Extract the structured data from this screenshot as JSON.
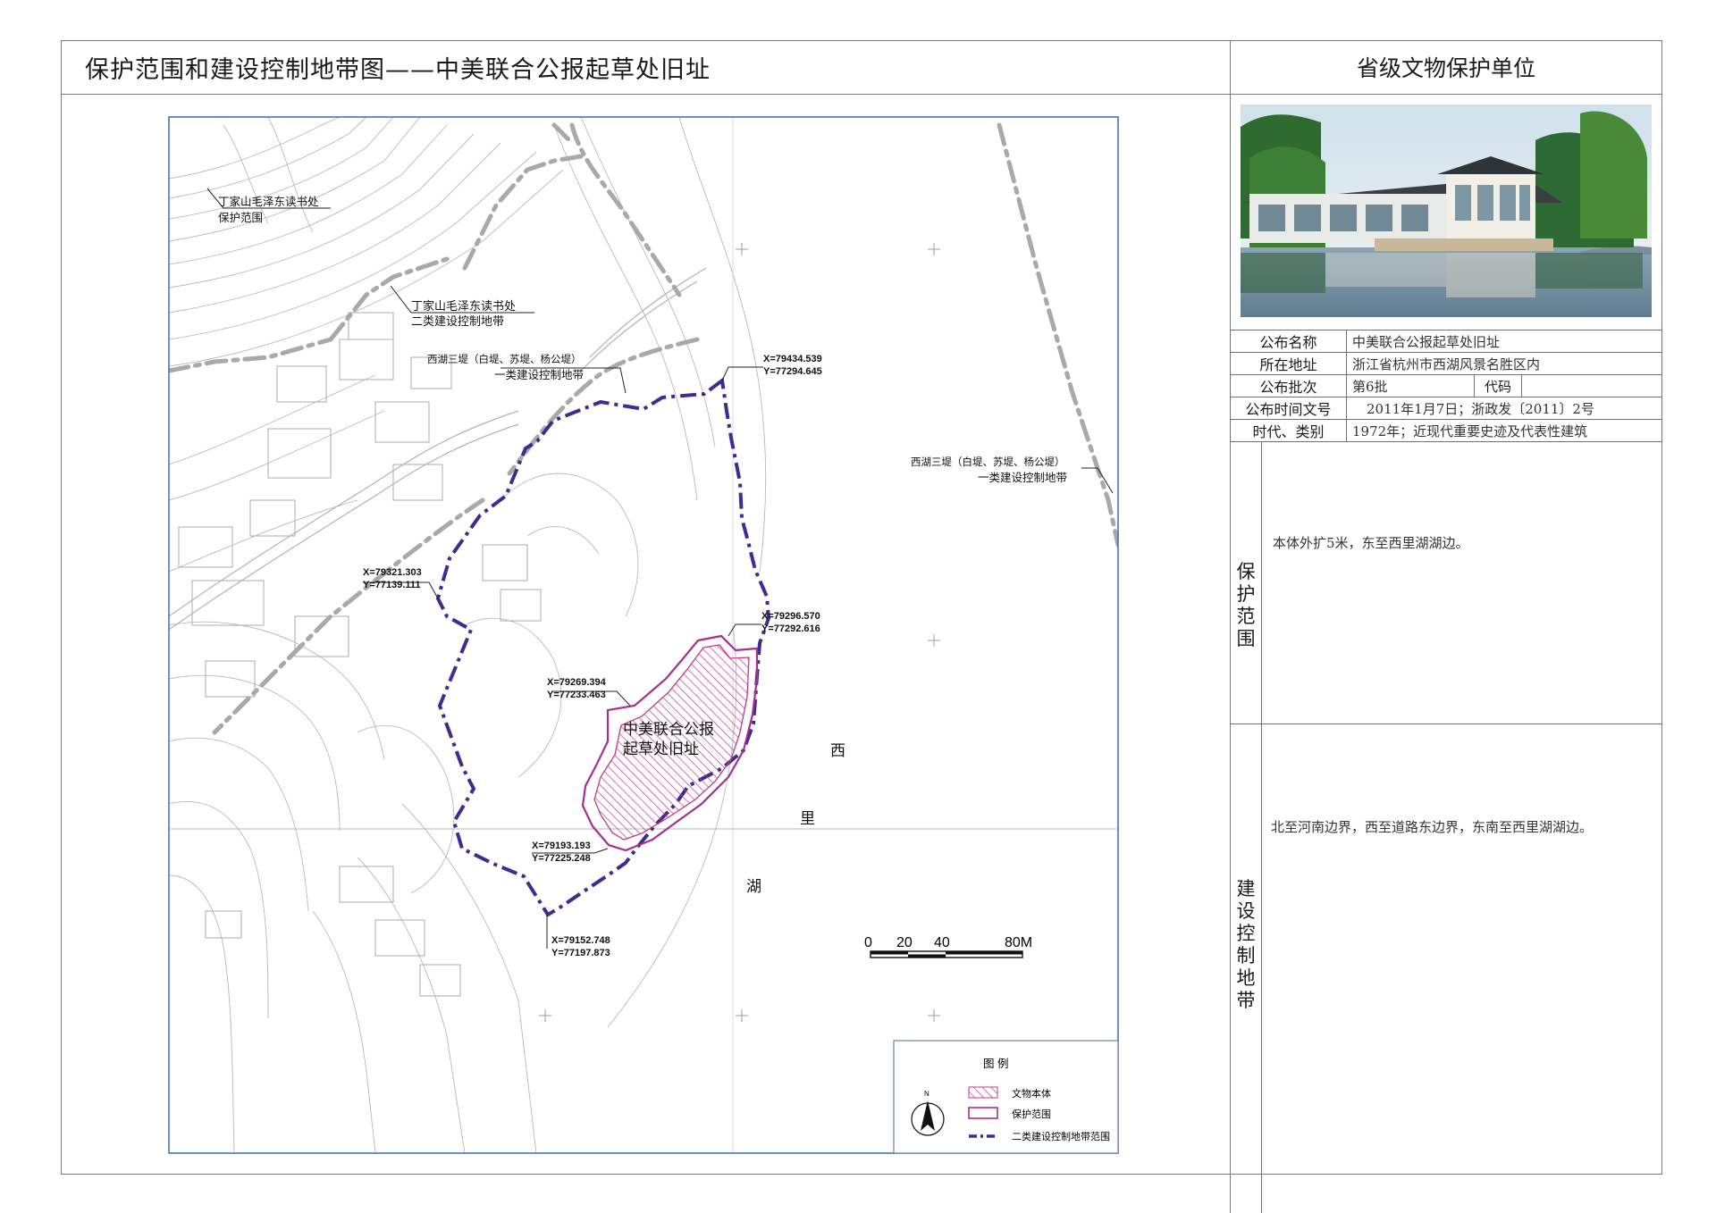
{
  "title": "保护范围和建设控制地带图——中美联合公报起草处旧址",
  "level": "省级文物保护单位",
  "map": {
    "labels": {
      "dingjia_protect_1": "丁家山毛泽东读书处",
      "dingjia_protect_2": "保护范围",
      "dingjia_control_1": "丁家山毛泽东读书处",
      "dingjia_control_2": "二类建设控制地带",
      "xihu_left_1": "西湖三堤（白堤、苏堤、杨公堤）",
      "xihu_left_2": "一类建设控制地带",
      "xihu_right_1": "西湖三堤（白堤、苏堤、杨公堤）",
      "xihu_right_2": "一类建设控制地带",
      "site_1": "中美联合公报",
      "site_2": "起草处旧址",
      "lake_1": "西",
      "lake_2": "里",
      "lake_3": "湖"
    },
    "coords": [
      {
        "x": "X=79434.539",
        "y": "Y=77294.645"
      },
      {
        "x": "X=79321.303",
        "y": "Y=77139.111"
      },
      {
        "x": "X=79296.570",
        "y": "Y=77292.616"
      },
      {
        "x": "X=79269.394",
        "y": "Y=77233.463"
      },
      {
        "x": "X=79193.193",
        "y": "Y=77225.248"
      },
      {
        "x": "X=79152.748",
        "y": "Y=77197.873"
      }
    ],
    "scale": {
      "t0": "0",
      "t1": "20",
      "t2": "40",
      "t3": "80M"
    },
    "north": "N",
    "legend": {
      "title": "图    例",
      "items": [
        {
          "label": "文物本体",
          "color": "#c03a8a"
        },
        {
          "label": "保护范围",
          "color": "#a52f8f"
        },
        {
          "label": "二类建设控制地带范围",
          "color": "#3b2e91"
        }
      ]
    }
  },
  "info": {
    "rows": [
      {
        "key": "公布名称",
        "value": "中美联合公报起草处旧址"
      },
      {
        "key": "所在地址",
        "value": "浙江省杭州市西湖风景名胜区内"
      },
      {
        "key": "公布批次",
        "value": "第6批",
        "code_label": "代码",
        "code_value": ""
      },
      {
        "key": "公布时间文号",
        "value": "2011年1月7日；浙政发〔2011〕2号"
      },
      {
        "key": "时代、类别",
        "value": "1972年；近现代重要史迹及代表性建筑"
      }
    ],
    "protection": {
      "heading": "保护范围",
      "text": "本体外扩5米，东至西里湖湖边。"
    },
    "control": {
      "heading": "建设控制地带",
      "text": "北至河南边界，西至道路东边界，东南至西里湖湖边。"
    }
  },
  "colors": {
    "site": "#c03a8a",
    "protect": "#a52f8f",
    "control": "#3b2e91",
    "dash_grey": "#a8aaa8",
    "map_frame": "#3f6ea6"
  }
}
